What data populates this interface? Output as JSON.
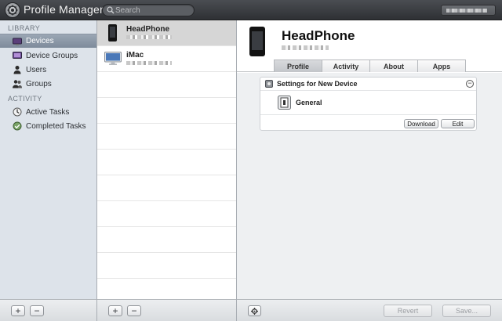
{
  "app": {
    "title": "Profile Manager",
    "search_placeholder": "Search",
    "user_icon": "account-menu-icon"
  },
  "sidebar": {
    "sections": [
      {
        "header": "LIBRARY",
        "items": [
          {
            "label": "Devices",
            "icon": "devices-icon",
            "selected": true
          },
          {
            "label": "Device Groups",
            "icon": "device-groups-icon"
          },
          {
            "label": "Users",
            "icon": "user-icon"
          },
          {
            "label": "Groups",
            "icon": "groups-icon"
          }
        ]
      },
      {
        "header": "ACTIVITY",
        "items": [
          {
            "label": "Active Tasks",
            "icon": "active-tasks-icon"
          },
          {
            "label": "Completed Tasks",
            "icon": "completed-tasks-icon"
          }
        ]
      }
    ],
    "footer": {
      "add": "+",
      "remove": "−"
    }
  },
  "device_list": {
    "rows": [
      {
        "name": "HeadPhone",
        "icon": "iphone-icon",
        "selected": true
      },
      {
        "name": "iMac",
        "icon": "imac-icon",
        "selected": false
      }
    ],
    "footer": {
      "add": "+",
      "remove": "−"
    }
  },
  "detail": {
    "title": "HeadPhone",
    "tabs": [
      {
        "label": "Profile",
        "active": true
      },
      {
        "label": "Activity"
      },
      {
        "label": "About"
      },
      {
        "label": "Apps"
      }
    ],
    "settings_card": {
      "title": "Settings for New Device",
      "collapse": "−",
      "payload": {
        "label": "General",
        "icon": "general-payload-icon"
      },
      "download_label": "Download",
      "edit_label": "Edit"
    },
    "footer": {
      "revert_label": "Revert",
      "save_label": "Save..."
    }
  }
}
